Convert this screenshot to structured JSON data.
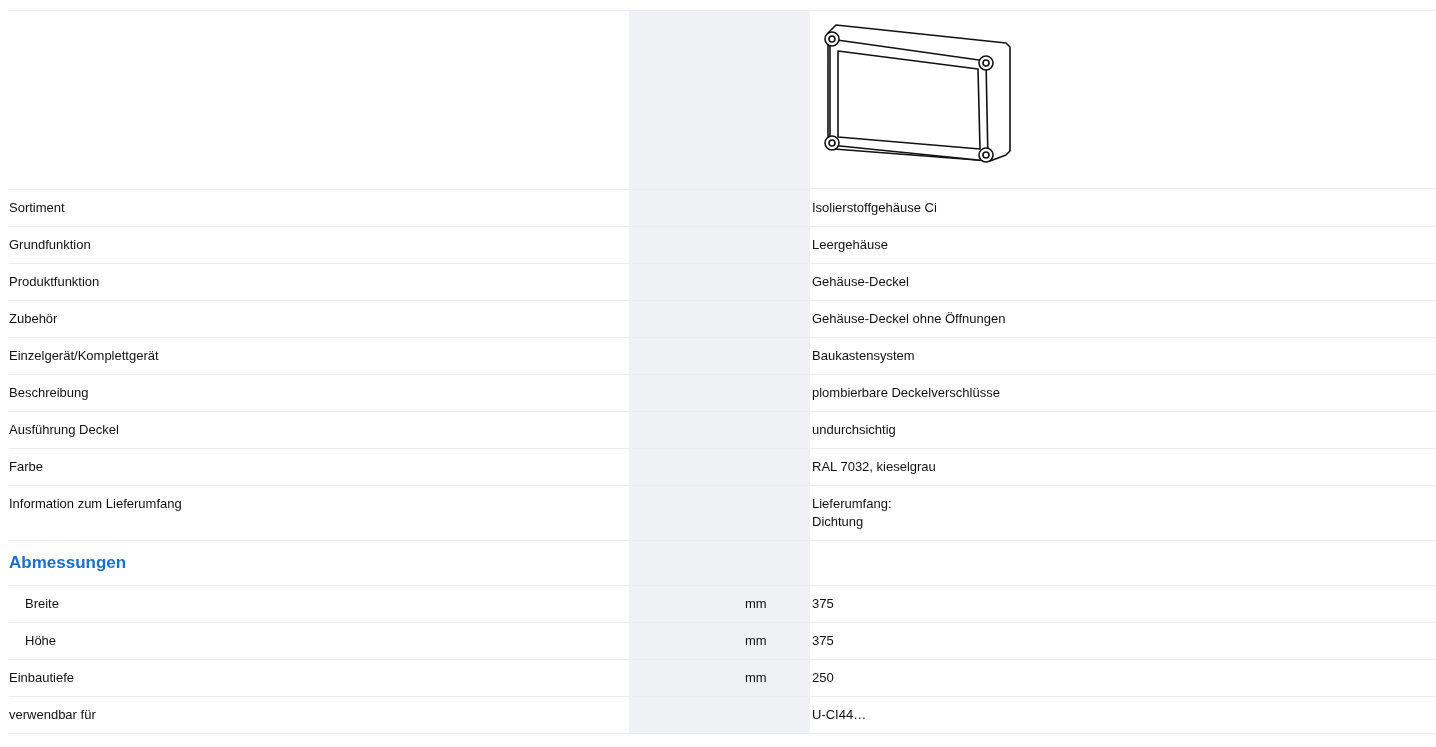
{
  "table": {
    "rows": [
      {
        "kind": "image"
      },
      {
        "kind": "property",
        "label": "Sortiment",
        "value": "Isolierstoffgehäuse Ci"
      },
      {
        "kind": "property",
        "label": "Grundfunktion",
        "value": "Leergehäuse"
      },
      {
        "kind": "property",
        "label": "Produktfunktion",
        "value": "Gehäuse-Deckel"
      },
      {
        "kind": "property",
        "label": "Zubehör",
        "value": "Gehäuse-Deckel ohne Öffnungen"
      },
      {
        "kind": "property",
        "label": "Einzelgerät/Komplettgerät",
        "value": "Baukastensystem"
      },
      {
        "kind": "property",
        "label": "Beschreibung",
        "value": "plombierbare Deckelverschlüsse"
      },
      {
        "kind": "property",
        "label": "Ausführung Deckel",
        "value": "undurchsichtig"
      },
      {
        "kind": "property",
        "label": "Farbe",
        "value": "RAL 7032, kieselgrau"
      },
      {
        "kind": "property",
        "label": "Information zum Lieferumfang",
        "value": "Lieferumfang:\nDichtung"
      },
      {
        "kind": "section",
        "label": "Abmessungen",
        "children": [
          {
            "kind": "property",
            "label": "Breite",
            "unit": "mm",
            "value": "375"
          },
          {
            "kind": "property",
            "label": "Höhe",
            "unit": "mm",
            "value": "375"
          }
        ]
      },
      {
        "kind": "property",
        "label": "Einbautiefe",
        "unit": "mm",
        "value": "250"
      },
      {
        "kind": "property",
        "label": "verwendbar für",
        "value": "U-CI44…"
      }
    ]
  }
}
